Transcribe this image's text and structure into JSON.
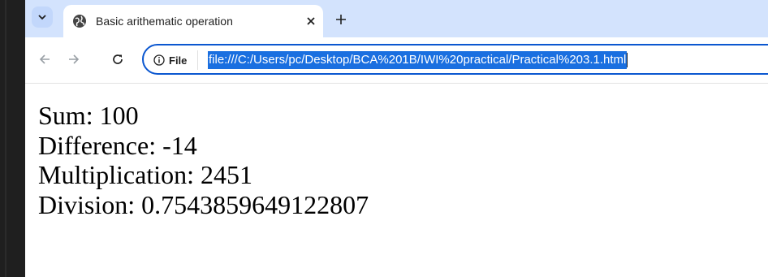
{
  "tab": {
    "title": "Basic arithematic operation"
  },
  "toolbar": {
    "chip_label": "File",
    "url": "file:///C:/Users/pc/Desktop/BCA%201B/IWI%20practical/Practical%203.1.html"
  },
  "results": [
    "Sum: 100",
    "Difference: -14",
    "Multiplication: 2451",
    "Division: 0.7543859649122807"
  ],
  "colors": {
    "tabstrip": "#d3e3fd",
    "omnibox_border": "#0b57d0",
    "selection": "#1a6fe0"
  },
  "icons": [
    "tab-search-icon",
    "globe-icon",
    "close-icon",
    "plus-icon",
    "back-arrow-icon",
    "forward-arrow-icon",
    "reload-icon",
    "info-icon"
  ]
}
